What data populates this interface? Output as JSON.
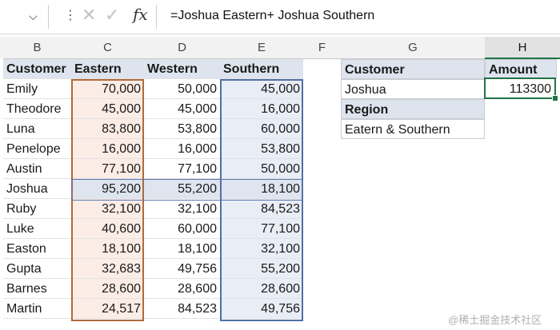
{
  "formula_bar": {
    "formula": "=Joshua Eastern+ Joshua Southern",
    "cancel_icon": "✕",
    "confirm_icon": "✓",
    "fx_label": "fx"
  },
  "columns": [
    "B",
    "C",
    "D",
    "E",
    "F",
    "G",
    "H"
  ],
  "table": {
    "headers": [
      "Customer",
      "Eastern",
      "Western",
      "Southern"
    ],
    "rows": [
      {
        "customer": "Emily",
        "eastern": "70,000",
        "western": "50,000",
        "southern": "45,000"
      },
      {
        "customer": "Theodore",
        "eastern": "45,000",
        "western": "45,000",
        "southern": "16,000"
      },
      {
        "customer": "Luna",
        "eastern": "83,800",
        "western": "53,800",
        "southern": "60,000"
      },
      {
        "customer": "Penelope",
        "eastern": "16,000",
        "western": "16,000",
        "southern": "53,800"
      },
      {
        "customer": "Austin",
        "eastern": "77,100",
        "western": "77,100",
        "southern": "50,000"
      },
      {
        "customer": "Joshua",
        "eastern": "95,200",
        "western": "55,200",
        "southern": "18,100"
      },
      {
        "customer": "Ruby",
        "eastern": "32,100",
        "western": "32,100",
        "southern": "84,523"
      },
      {
        "customer": "Luke",
        "eastern": "40,600",
        "western": "60,000",
        "southern": "77,100"
      },
      {
        "customer": "Easton",
        "eastern": "18,100",
        "western": "18,100",
        "southern": "32,100"
      },
      {
        "customer": "Gupta",
        "eastern": "32,683",
        "western": "49,756",
        "southern": "55,200"
      },
      {
        "customer": "Barnes",
        "eastern": "28,600",
        "western": "28,600",
        "southern": "28,600"
      },
      {
        "customer": "Martin",
        "eastern": "24,517",
        "western": "84,523",
        "southern": "49,756"
      }
    ]
  },
  "lookup": {
    "customer_label": "Customer",
    "customer_value": "Joshua",
    "amount_label": "Amount",
    "amount_value": "113300",
    "region_label": "Region",
    "region_value": "Eatern & Southern"
  },
  "watermark": "@稀土掘金技术社区",
  "colors": {
    "eastern_border": "#b06a3a",
    "southern_border": "#4f6fa8",
    "selection_green": "#217346",
    "header_fill": "#dde4ee"
  }
}
